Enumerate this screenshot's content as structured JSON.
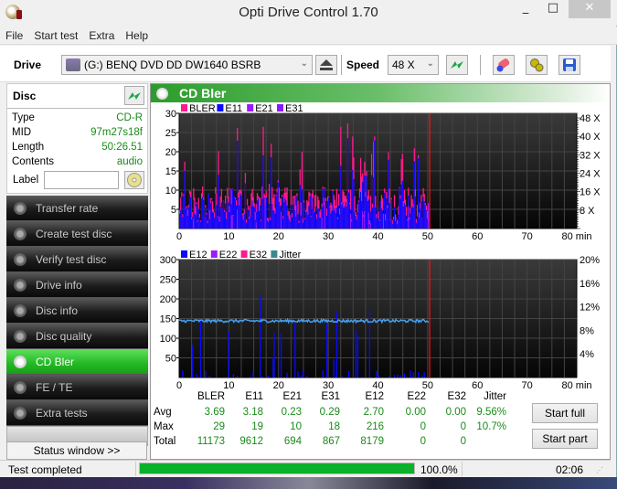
{
  "window": {
    "title": "Opti Drive Control 1.70",
    "minimize_glyph": "_",
    "maximize_glyph": "□",
    "close_glyph": "✕"
  },
  "menu": [
    "File",
    "Start test",
    "Extra",
    "Help"
  ],
  "toolbar": {
    "drive_label": "Drive",
    "drive_value": "(G:)  BENQ DVD DD DW1640 BSRB",
    "speed_label": "Speed",
    "speed_value": "48 X",
    "icons": [
      "eject-icon",
      "refresh-icon",
      "erase-icon",
      "settings-icon",
      "save-icon"
    ]
  },
  "disc": {
    "heading": "Disc",
    "rows": [
      {
        "label": "Type",
        "value": "CD-R"
      },
      {
        "label": "MID",
        "value": "97m27s18f"
      },
      {
        "label": "Length",
        "value": "50:26.51"
      },
      {
        "label": "Contents",
        "value": "audio"
      }
    ],
    "label_field_label": "Label",
    "label_field_value": ""
  },
  "nav": [
    {
      "label": "Transfer rate",
      "active": false
    },
    {
      "label": "Create test disc",
      "active": false
    },
    {
      "label": "Verify test disc",
      "active": false
    },
    {
      "label": "Drive info",
      "active": false
    },
    {
      "label": "Disc info",
      "active": false
    },
    {
      "label": "Disc quality",
      "active": false
    },
    {
      "label": "CD Bler",
      "active": true
    },
    {
      "label": "FE / TE",
      "active": false
    },
    {
      "label": "Extra tests",
      "active": false
    }
  ],
  "status_window_label": "Status window >>",
  "panel_title": "CD Bler",
  "chart_data": [
    {
      "type": "bar",
      "title": "BLER / E11 / E21 / E31",
      "legend": [
        {
          "name": "BLER",
          "color": "#ff1a8c"
        },
        {
          "name": "E11",
          "color": "#0a0aff"
        },
        {
          "name": "E21",
          "color": "#9b1aff"
        },
        {
          "name": "E31",
          "color": "#8a1aff"
        }
      ],
      "xlim": [
        0,
        80
      ],
      "xticks": [
        0,
        10,
        20,
        30,
        40,
        50,
        60,
        70,
        80
      ],
      "xlabel": "min",
      "ylim": [
        0,
        30
      ],
      "yticks": [
        5,
        10,
        15,
        20,
        25,
        30
      ],
      "y2_ticks": [
        "8 X",
        "16 X",
        "24 X",
        "32 X",
        "40 X",
        "48 X"
      ],
      "y2lim": [
        0,
        48
      ],
      "end_marker_min": 50.4,
      "series": [
        {
          "name": "BLER",
          "max": 29,
          "avg": 3.69
        },
        {
          "name": "E11",
          "max": 19,
          "avg": 3.18
        },
        {
          "name": "E21",
          "max": 10,
          "avg": 0.23
        },
        {
          "name": "E31",
          "max": 18,
          "avg": 0.29
        }
      ],
      "grid": true
    },
    {
      "type": "bar",
      "title": "E12 / E22 / E32 / Jitter",
      "legend": [
        {
          "name": "E12",
          "color": "#0a0aff"
        },
        {
          "name": "E22",
          "color": "#9b1aff"
        },
        {
          "name": "E32",
          "color": "#ff1a8c"
        },
        {
          "name": "Jitter",
          "color": "#3a8a8a"
        }
      ],
      "xlim": [
        0,
        80
      ],
      "xticks": [
        0,
        10,
        20,
        30,
        40,
        50,
        60,
        70,
        80
      ],
      "xlabel": "min",
      "ylim": [
        0,
        300
      ],
      "yticks": [
        50,
        100,
        150,
        200,
        250,
        300
      ],
      "y2_ticks": [
        "4%",
        "8%",
        "12%",
        "16%",
        "20%"
      ],
      "y2lim": [
        0,
        20
      ],
      "end_marker_min": 50.4,
      "series": [
        {
          "name": "E12",
          "max": 216,
          "avg": 2.7
        },
        {
          "name": "E22",
          "max": 0,
          "avg": 0.0
        },
        {
          "name": "E32",
          "max": 0,
          "avg": 0.0
        },
        {
          "name": "Jitter",
          "max_percent": 10.7,
          "avg_percent": 9.56
        }
      ],
      "grid": true
    }
  ],
  "stats": {
    "columns": [
      "BLER",
      "E11",
      "E21",
      "E31",
      "E12",
      "E22",
      "E32",
      "Jitter"
    ],
    "rows": [
      {
        "label": "Avg",
        "values": [
          "3.69",
          "3.18",
          "0.23",
          "0.29",
          "2.70",
          "0.00",
          "0.00",
          "9.56%"
        ]
      },
      {
        "label": "Max",
        "values": [
          "29",
          "19",
          "10",
          "18",
          "216",
          "0",
          "0",
          "10.7%"
        ]
      },
      {
        "label": "Total",
        "values": [
          "11173",
          "9612",
          "694",
          "867",
          "8179",
          "0",
          "0",
          ""
        ]
      }
    ]
  },
  "buttons": {
    "start_full": "Start full",
    "start_part": "Start part"
  },
  "statusbar": {
    "message": "Test completed",
    "progress_percent": 100.0,
    "progress_label": "100.0%",
    "elapsed": "02:06"
  }
}
